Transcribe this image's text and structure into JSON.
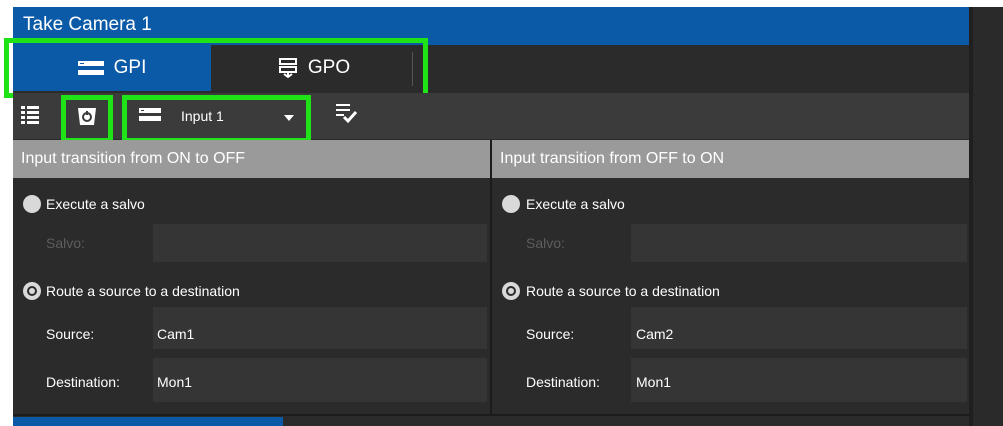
{
  "window": {
    "title": "Take Camera 1"
  },
  "tabs": [
    {
      "label": "GPI",
      "icon": "gpi-icon",
      "selected": true
    },
    {
      "label": "GPO",
      "icon": "gpo-icon",
      "selected": false
    }
  ],
  "toolbar": {
    "list_icon": "list-icon",
    "shield_icon": "shield-icon",
    "input_icon": "gpi-input-icon",
    "input_selected": "Input 1",
    "apply_icon": "checklist-icon"
  },
  "sections": {
    "off": {
      "header": "Input transition from ON to OFF",
      "salvo_option": "Execute a salvo",
      "salvo_label": "Salvo:",
      "route_option": "Route a source to a destination",
      "source_label": "Source:",
      "source_value": "Cam1",
      "dest_label": "Destination:",
      "dest_value": "Mon1",
      "selected": "route"
    },
    "on": {
      "header": "Input transition from OFF to ON",
      "salvo_option": "Execute a salvo",
      "salvo_label": "Salvo:",
      "route_option": "Route a source to a destination",
      "source_label": "Source:",
      "source_value": "Cam2",
      "dest_label": "Destination:",
      "dest_value": "Mon1",
      "selected": "route"
    }
  },
  "colors": {
    "accent": "#0b5aa8",
    "highlight": "#1fe317",
    "panel": "#2b2b2b",
    "header": "#9a9a9a"
  }
}
